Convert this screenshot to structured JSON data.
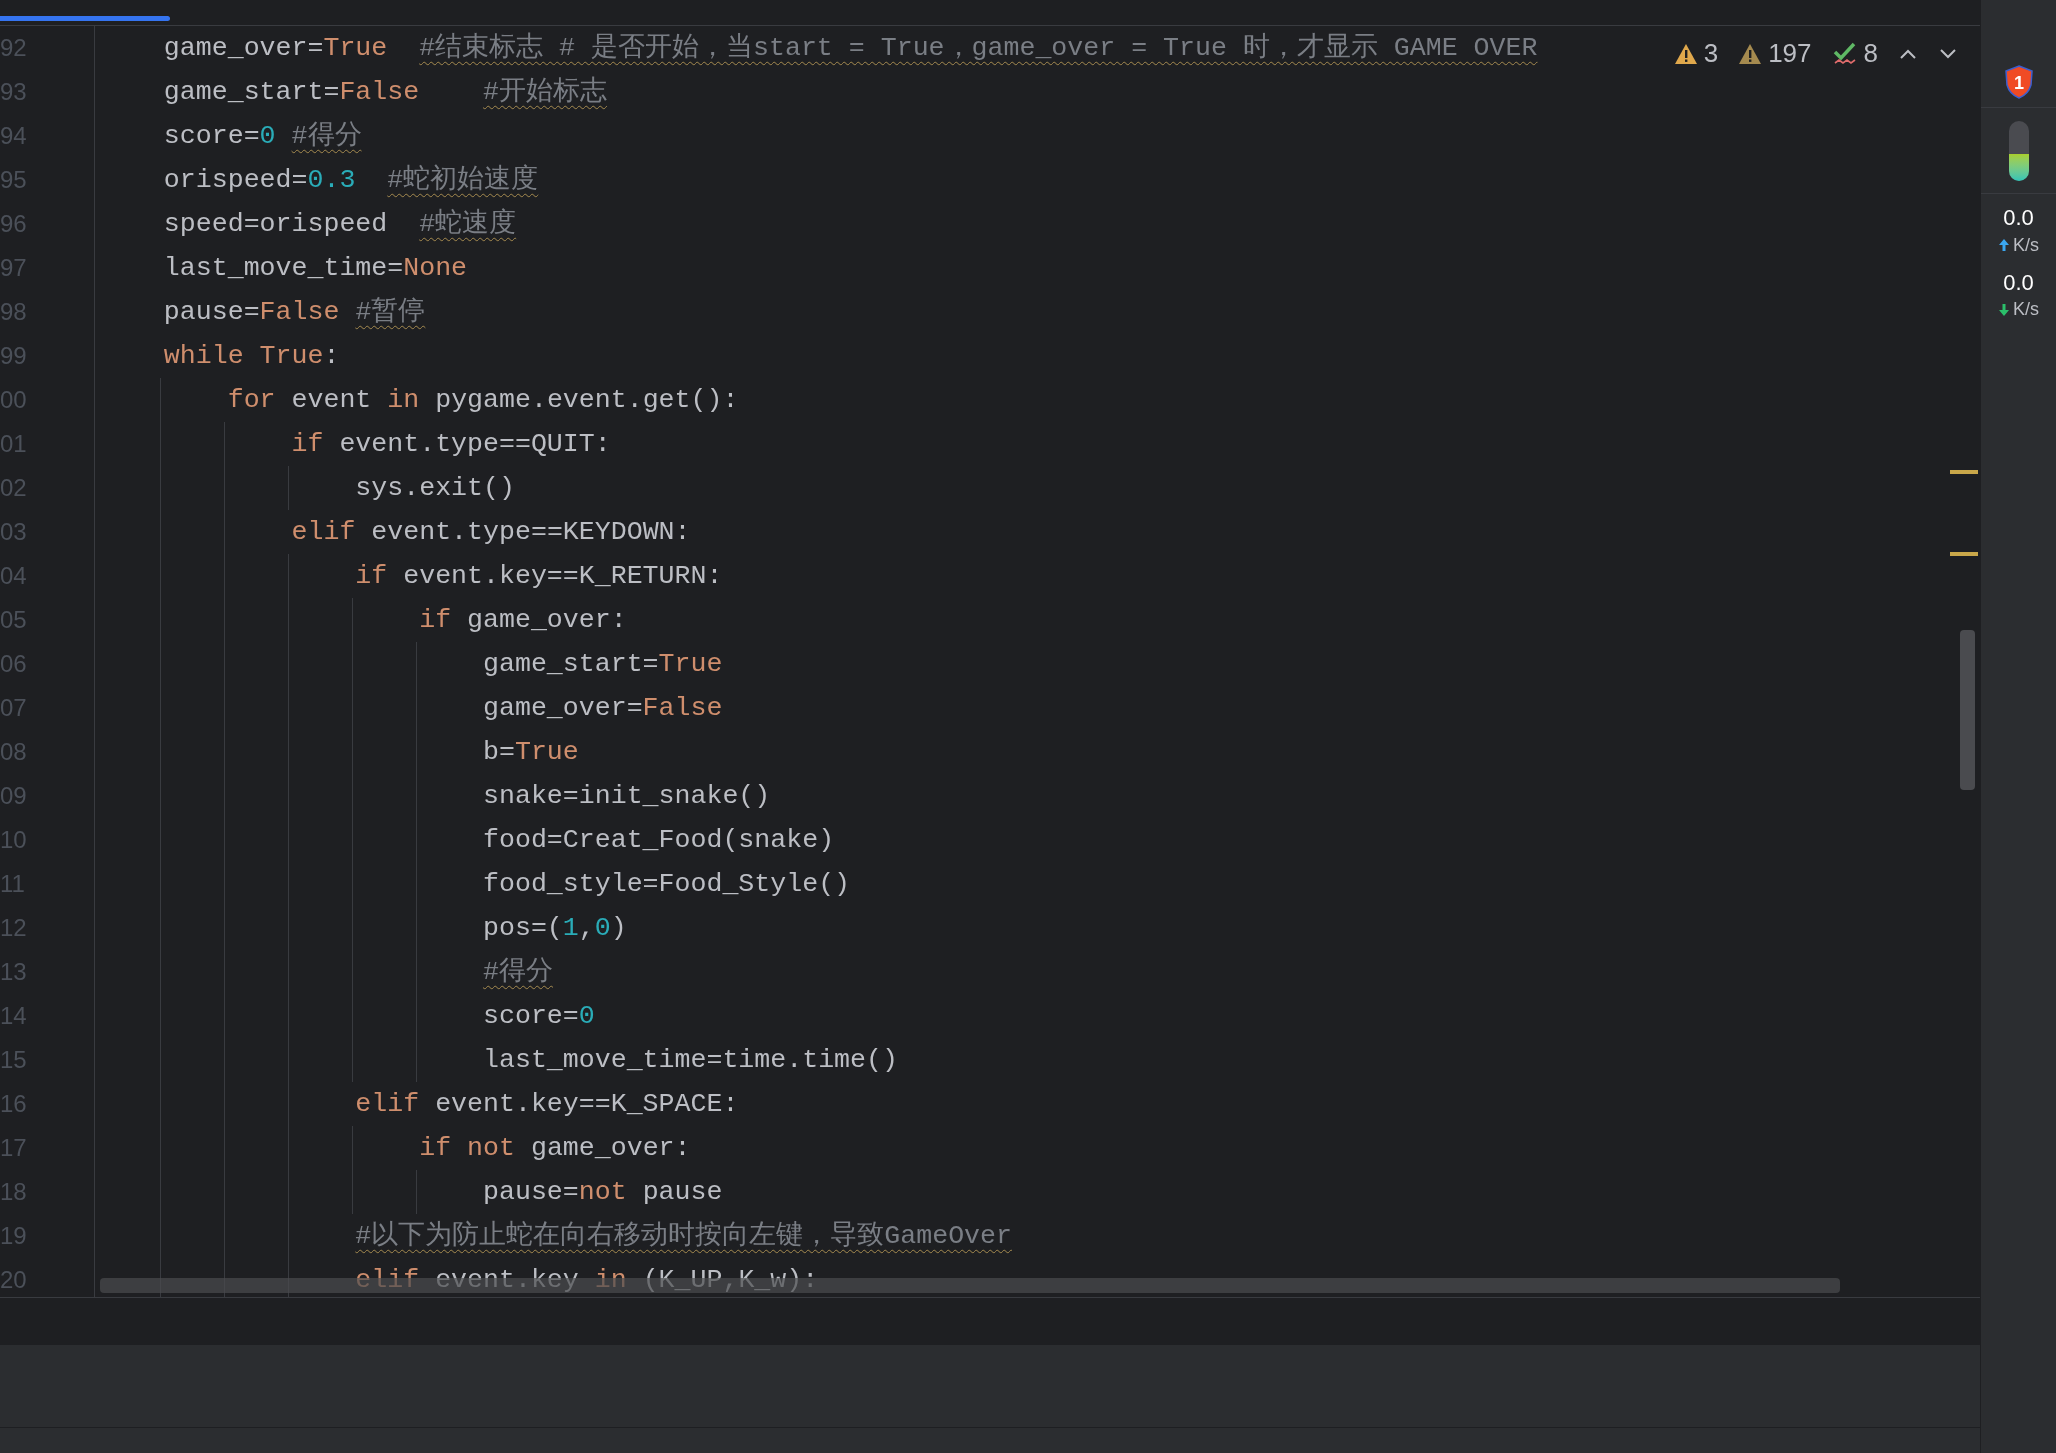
{
  "progress": {
    "level": 0.086
  },
  "editor": {
    "lines": [
      {
        "number": "92",
        "tokens": [
          {
            "kind": "code",
            "text": "    game_over="
          },
          {
            "kind": "keyword",
            "text": "True  "
          },
          {
            "kind": "comment",
            "text": "#结束标志 # 是否开始，当start = True，game_over = True 时，才显示 GAME OVER"
          }
        ]
      },
      {
        "number": "93",
        "tokens": [
          {
            "kind": "code",
            "text": "    game_start="
          },
          {
            "kind": "keyword",
            "text": "False    "
          },
          {
            "kind": "comment",
            "text": "#开始标志"
          }
        ]
      },
      {
        "number": "94",
        "tokens": [
          {
            "kind": "code",
            "text": "    score="
          },
          {
            "kind": "number",
            "text": "0 "
          },
          {
            "kind": "comment",
            "text": "#得分"
          }
        ]
      },
      {
        "number": "95",
        "tokens": [
          {
            "kind": "code",
            "text": "    orispeed="
          },
          {
            "kind": "number",
            "text": "0.3  "
          },
          {
            "kind": "comment",
            "text": "#蛇初始速度"
          }
        ]
      },
      {
        "number": "96",
        "tokens": [
          {
            "kind": "code",
            "text": "    speed=orispeed  "
          },
          {
            "kind": "comment",
            "text": "#蛇速度"
          }
        ]
      },
      {
        "number": "97",
        "tokens": [
          {
            "kind": "code",
            "text": "    last_move_time="
          },
          {
            "kind": "keyword",
            "text": "None"
          }
        ]
      },
      {
        "number": "98",
        "tokens": [
          {
            "kind": "code",
            "text": "    pause="
          },
          {
            "kind": "keyword",
            "text": "False "
          },
          {
            "kind": "comment",
            "text": "#暂停"
          }
        ]
      },
      {
        "number": "99",
        "tokens": [
          {
            "kind": "keyword",
            "text": "    while True"
          },
          {
            "kind": "code",
            "text": ":"
          }
        ]
      },
      {
        "number": "00",
        "tokens": [
          {
            "kind": "keyword",
            "text": "        for"
          },
          {
            "kind": "code",
            "text": " event "
          },
          {
            "kind": "keyword",
            "text": "in"
          },
          {
            "kind": "code",
            "text": " pygame.event.get():"
          }
        ]
      },
      {
        "number": "01",
        "tokens": [
          {
            "kind": "keyword",
            "text": "            if"
          },
          {
            "kind": "code",
            "text": " event.type==QUIT:"
          }
        ]
      },
      {
        "number": "02",
        "tokens": [
          {
            "kind": "code",
            "text": "                sys.exit()"
          }
        ]
      },
      {
        "number": "03",
        "tokens": [
          {
            "kind": "keyword",
            "text": "            elif"
          },
          {
            "kind": "code",
            "text": " event.type==KEYDOWN:"
          }
        ]
      },
      {
        "number": "04",
        "tokens": [
          {
            "kind": "keyword",
            "text": "                if"
          },
          {
            "kind": "code",
            "text": " event.key==K_RETURN:"
          }
        ]
      },
      {
        "number": "05",
        "tokens": [
          {
            "kind": "keyword",
            "text": "                    if"
          },
          {
            "kind": "code",
            "text": " game_over:"
          }
        ]
      },
      {
        "number": "06",
        "tokens": [
          {
            "kind": "code",
            "text": "                        game_start="
          },
          {
            "kind": "keyword",
            "text": "True"
          }
        ]
      },
      {
        "number": "07",
        "tokens": [
          {
            "kind": "code",
            "text": "                        game_over="
          },
          {
            "kind": "keyword",
            "text": "False"
          }
        ]
      },
      {
        "number": "08",
        "tokens": [
          {
            "kind": "code",
            "text": "                        b="
          },
          {
            "kind": "keyword",
            "text": "True"
          }
        ]
      },
      {
        "number": "09",
        "tokens": [
          {
            "kind": "code",
            "text": "                        snake=init_snake()"
          }
        ]
      },
      {
        "number": "10",
        "tokens": [
          {
            "kind": "code",
            "text": "                        food=Creat_Food(snake)"
          }
        ]
      },
      {
        "number": "11",
        "tokens": [
          {
            "kind": "code",
            "text": "                        food_style=Food_Style()"
          }
        ]
      },
      {
        "number": "12",
        "tokens": [
          {
            "kind": "code",
            "text": "                        pos=("
          },
          {
            "kind": "number",
            "text": "1"
          },
          {
            "kind": "code",
            "text": ","
          },
          {
            "kind": "number",
            "text": "0"
          },
          {
            "kind": "code",
            "text": ")"
          }
        ]
      },
      {
        "number": "13",
        "tokens": [
          {
            "kind": "comment",
            "text": "                        #得分"
          }
        ]
      },
      {
        "number": "14",
        "tokens": [
          {
            "kind": "code",
            "text": "                        score="
          },
          {
            "kind": "number",
            "text": "0"
          }
        ]
      },
      {
        "number": "15",
        "tokens": [
          {
            "kind": "code",
            "text": "                        last_move_time=time.time()"
          }
        ]
      },
      {
        "number": "16",
        "tokens": [
          {
            "kind": "keyword",
            "text": "                elif"
          },
          {
            "kind": "code",
            "text": " event.key==K_SPACE:"
          }
        ]
      },
      {
        "number": "17",
        "tokens": [
          {
            "kind": "keyword",
            "text": "                    if not"
          },
          {
            "kind": "code",
            "text": " game_over:"
          }
        ]
      },
      {
        "number": "18",
        "tokens": [
          {
            "kind": "code",
            "text": "                        pause="
          },
          {
            "kind": "keyword",
            "text": "not"
          },
          {
            "kind": "code",
            "text": " pause"
          }
        ]
      },
      {
        "number": "19",
        "tokens": [
          {
            "kind": "comment",
            "text": "                #以下为防止蛇在向右移动时按向左键，导致GameOver"
          }
        ]
      },
      {
        "number": "20",
        "tokens": [
          {
            "kind": "keyword",
            "text": "                elif"
          },
          {
            "kind": "code",
            "text": " event.key "
          },
          {
            "kind": "keyword",
            "text": "in"
          },
          {
            "kind": "code",
            "text": " (K_UP,K_w):"
          }
        ]
      }
    ]
  },
  "inspections": [
    {
      "kind": "warning",
      "count": "3"
    },
    {
      "kind": "weak_warning",
      "count": "197"
    },
    {
      "kind": "typo",
      "count": "8"
    }
  ],
  "side_widget": {
    "badge": "1",
    "memory": {
      "level": 0.45
    },
    "rates": [
      {
        "kind": "upload",
        "value": "0.0",
        "unit": "K/s"
      },
      {
        "kind": "download",
        "value": "0.0",
        "unit": "K/s"
      }
    ]
  }
}
